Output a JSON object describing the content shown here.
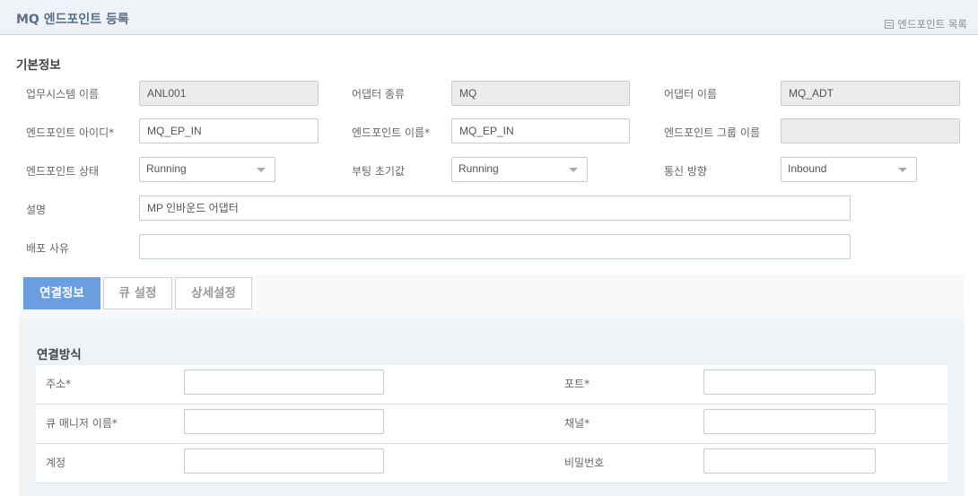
{
  "header": {
    "title": "MQ 엔드포인트 등록",
    "list_link": "엔드포인트 목록",
    "list_icon": "list-icon"
  },
  "basic": {
    "section_title": "기본정보",
    "fields": {
      "biz_system_name": {
        "label": "업무시스템 이름",
        "value": "ANL001"
      },
      "adapter_type": {
        "label": "어댑터 종류",
        "value": "MQ"
      },
      "adapter_name": {
        "label": "어댑터 이름",
        "value": "MQ_ADT"
      },
      "endpoint_id": {
        "label": "엔드포인트 아이디*",
        "value": "MQ_EP_IN"
      },
      "endpoint_name": {
        "label": "엔드포인트 이름*",
        "value": "MQ_EP_IN"
      },
      "endpoint_group_name": {
        "label": "엔드포인트 그룹 이름",
        "value": ""
      },
      "endpoint_status": {
        "label": "엔드포인트 상태",
        "value": "Running"
      },
      "boot_initial": {
        "label": "부팅 초기값",
        "value": "Running"
      },
      "direction": {
        "label": "통신 방향",
        "value": "Inbound"
      },
      "description": {
        "label": "설명",
        "value": "MP 인바운드 어댑터"
      },
      "deploy_reason": {
        "label": "배포 사유",
        "value": ""
      }
    }
  },
  "tabs": [
    {
      "label": "연결정보",
      "active": true
    },
    {
      "label": "큐 설정",
      "active": false
    },
    {
      "label": "상세설정",
      "active": false
    }
  ],
  "connection": {
    "title": "연결방식",
    "rows": [
      {
        "left_label": "주소*",
        "left_value": "",
        "right_label": "포트*",
        "right_value": ""
      },
      {
        "left_label": "큐 매니저 이름*",
        "left_value": "",
        "right_label": "채널*",
        "right_value": ""
      },
      {
        "left_label": "계정",
        "left_value": "",
        "right_label": "비밀번호",
        "right_value": ""
      }
    ]
  },
  "colors": {
    "accent": "#6a9ede",
    "header_bg": "#eff3f7",
    "title": "#5a6f88",
    "readonly_bg": "#ececec"
  }
}
